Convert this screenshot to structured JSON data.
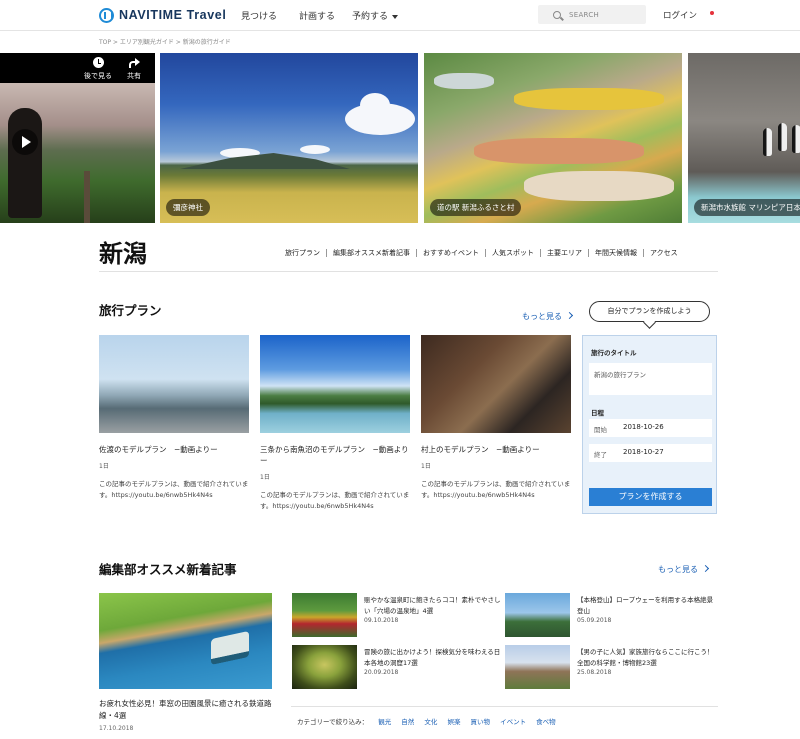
{
  "header": {
    "logo_text": "NAVITIME Travel",
    "nav": [
      "見つける",
      "計画する",
      "予約する"
    ],
    "search_placeholder": "SEARCH",
    "login": "ログイン"
  },
  "breadcrumb": "TOP > エリア別観光ガイド > 新潟の旅行ガイド",
  "hero": {
    "video_controls": {
      "watch_later": "後で見る",
      "share": "共有"
    },
    "tiles": [
      "彌彦神社",
      "道の駅 新潟ふるさと村",
      "新潟市水族館 マリンピア日本"
    ]
  },
  "city_title": "新潟",
  "section_nav": [
    "旅行プラン",
    "編集部オススメ新着記事",
    "おすすめイベント",
    "人気スポット",
    "主要エリア",
    "年間天候情報",
    "アクセス"
  ],
  "travel_plans": {
    "heading": "旅行プラン",
    "more": "もっと見る",
    "cards": [
      {
        "title": "佐渡のモデルプラン　−動画よりー",
        "days": "1日",
        "desc": "この記事のモデルプランは、動画で紹介されています。https://youtu.be/6nwb5Hk4N4s"
      },
      {
        "title": "三条から南魚沼のモデルプラン　−動画よりー",
        "days": "1日",
        "desc": "この記事のモデルプランは、動画で紹介されています。https://youtu.be/6nwb5Hk4N4s"
      },
      {
        "title": "村上のモデルプラン　−動画よりー",
        "days": "1日",
        "desc": "この記事のモデルプランは、動画で紹介されています。https://youtu.be/6nwb5Hk4N4s"
      }
    ]
  },
  "plan_form": {
    "bubble": "自分でプランを作成しよう",
    "title_label": "旅行のタイトル",
    "title_value": "新潟の旅行プラン",
    "date_label": "日程",
    "start_label": "開始",
    "start_value": "2018-10-26",
    "end_label": "終了",
    "end_value": "2018-10-27",
    "submit": "プランを作成する"
  },
  "articles": {
    "heading": "編集部オススメ新着記事",
    "more": "もっと見る",
    "featured": {
      "title": "お疲れ女性必見！車窓の田園風景に癒される鉄道路線・4選",
      "date": "17.10.2018"
    },
    "items": [
      {
        "title": "賑やかな温泉町に飽きたらココ！素朴でやさしい「穴場の温泉地」4選",
        "date": "09.10.2018"
      },
      {
        "title": "【本格登山】ロープウェーを利用する本格絶景登山",
        "date": "05.09.2018"
      },
      {
        "title": "冒険の旅に出かけよう！探検気分を味わえる日本各地の洞窟17選",
        "date": "20.09.2018"
      },
      {
        "title": "【男の子に人気】家族旅行ならここに行こう！全国の科学館・博物館23選",
        "date": "25.08.2018"
      }
    ],
    "category_label": "カテゴリーで絞り込み：",
    "categories": [
      "観光",
      "自然",
      "文化",
      "娯楽",
      "買い物",
      "イベント",
      "食べ物"
    ]
  }
}
